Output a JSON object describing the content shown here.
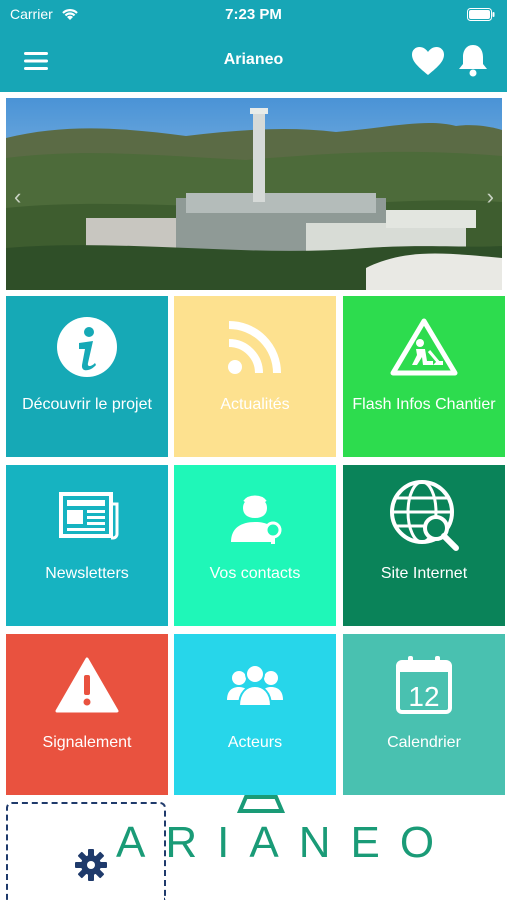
{
  "status": {
    "carrier": "Carrier",
    "time": "7:23 PM"
  },
  "header": {
    "title": "Arianeo"
  },
  "tiles": [
    {
      "label": "Découvrir le projet",
      "icon": "info-icon",
      "color": "#16a9b6"
    },
    {
      "label": "Actualités",
      "icon": "rss-icon",
      "color": "#fde18f"
    },
    {
      "label": "Flash Infos Chantier",
      "icon": "construction-warning-icon",
      "color": "#2ddc4e"
    },
    {
      "label": "Newsletters",
      "icon": "newspaper-icon",
      "color": "#16b3c1"
    },
    {
      "label": "Vos contacts",
      "icon": "contact-person-icon",
      "color": "#1ff7b8"
    },
    {
      "label": "Site Internet",
      "icon": "globe-search-icon",
      "color": "#0a8359"
    },
    {
      "label": "Signalement",
      "icon": "alert-icon",
      "color": "#e9523f"
    },
    {
      "label": "Acteurs",
      "icon": "group-icon",
      "color": "#27d6ea"
    },
    {
      "label": "Calendrier",
      "icon": "calendar-icon",
      "color": "#49c1b0"
    }
  ],
  "calendar_day": "12",
  "footer": {
    "logo_text": "ARIANEO"
  },
  "colors": {
    "primary": "#17a6b6",
    "logo": "#1a9b77",
    "settings": "#1f3a6b"
  }
}
